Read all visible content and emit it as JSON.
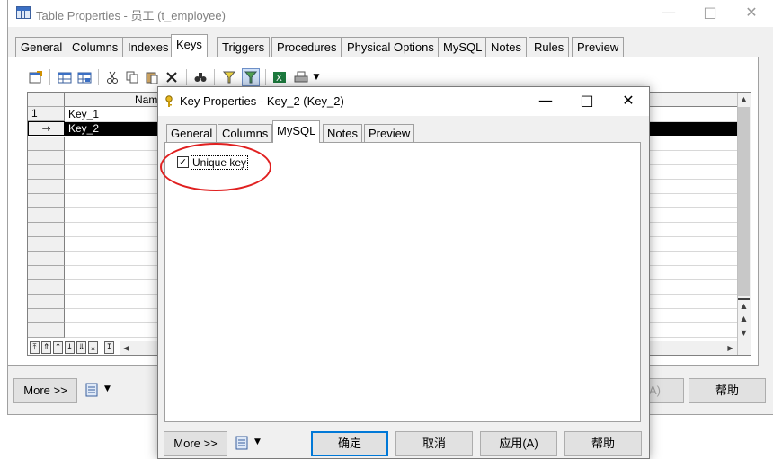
{
  "outer_window": {
    "title": "Table Properties - 员工 (t_employee)",
    "tabs": [
      "General",
      "Columns",
      "Indexes",
      "Keys",
      "Triggers",
      "Procedures",
      "Physical Options",
      "MySQL",
      "Notes",
      "Rules",
      "Preview"
    ],
    "active_tab": "Keys",
    "grid": {
      "column_header": "Name",
      "rows": [
        {
          "marker": "1",
          "name": "Key_1"
        },
        {
          "marker": "→",
          "name": "Key_2"
        }
      ]
    },
    "buttons": {
      "more": "More >>",
      "apply_partial": "A)",
      "help": "帮助"
    }
  },
  "inner_dialog": {
    "title": "Key Properties - Key_2 (Key_2)",
    "tabs": [
      "General",
      "Columns",
      "MySQL",
      "Notes",
      "Preview"
    ],
    "active_tab": "MySQL",
    "unique_key": {
      "label": "Unique key",
      "checked": true
    },
    "buttons": {
      "more": "More >>",
      "ok": "确定",
      "cancel": "取消",
      "apply": "应用(A)",
      "help": "帮助"
    }
  },
  "colors": {
    "annotation": "#e02020",
    "focus_border": "#0078d7",
    "selected_row": "#000000"
  }
}
